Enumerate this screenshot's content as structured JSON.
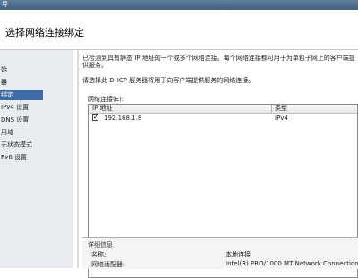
{
  "window": {
    "title": "导"
  },
  "header": {
    "title": "选择网络连接绑定"
  },
  "nav": {
    "items": [
      {
        "label": "始"
      },
      {
        "label": "器"
      },
      {
        "label": "绑定"
      },
      {
        "label": "IPv4 设置"
      },
      {
        "label": "DNS 设置"
      },
      {
        "label": "用域"
      },
      {
        "label": "无状态模式"
      },
      {
        "label": "Pv6 设置"
      }
    ],
    "selected_index": 2
  },
  "content": {
    "description1": "已检测到具有静态 IP 地址的一个或多个网络连接。每个网络连接都可用于为单独子网上的客户端提供服务。",
    "description2": "请选择此 DHCP 服务器将用于向客户端提供服务的网络连接。",
    "group_label": "网络连接(E):",
    "columns": {
      "ip": "IP 地址",
      "type": "类型"
    },
    "rows": [
      {
        "checked": true,
        "ip": "192.168.1.8",
        "type": "IPv4"
      }
    ]
  },
  "details": {
    "title": "详细信息",
    "name_label": "名称:",
    "name_value": "本地连接",
    "adapter_label": "网络适配器:",
    "adapter_value": "Intel(R) PRO/1000 MT Network Connection"
  }
}
